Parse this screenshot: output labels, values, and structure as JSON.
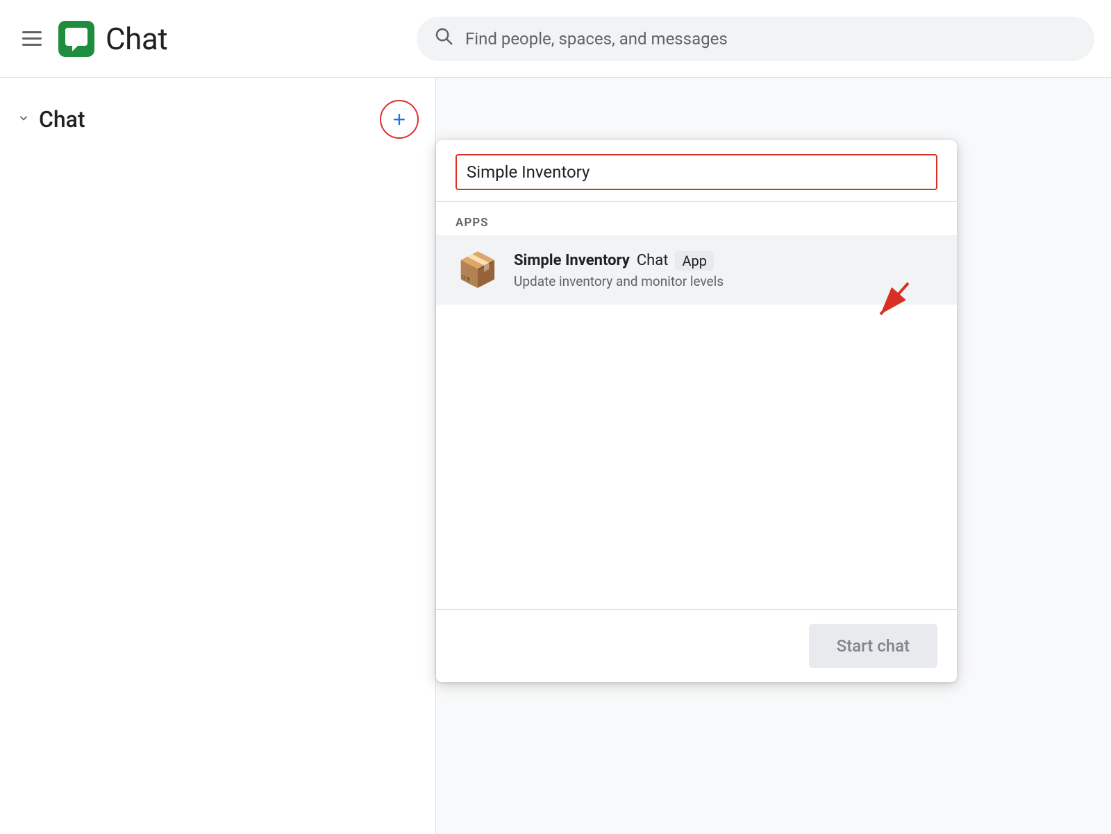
{
  "header": {
    "menu_icon": "hamburger-menu",
    "logo_icon": "chat-logo",
    "app_title": "Chat",
    "search_placeholder": "Find people, spaces, and messages"
  },
  "sidebar": {
    "chat_section_label": "Chat",
    "add_button_label": "+"
  },
  "dropdown": {
    "search_value": "Simple Inventory",
    "apps_section_label": "APPS",
    "app_item": {
      "name": "Simple Inventory",
      "type": "Chat",
      "badge": "App",
      "description": "Update inventory and monitor levels",
      "icon": "📦"
    },
    "arrow_annotation": "→",
    "start_chat_label": "Start chat"
  }
}
